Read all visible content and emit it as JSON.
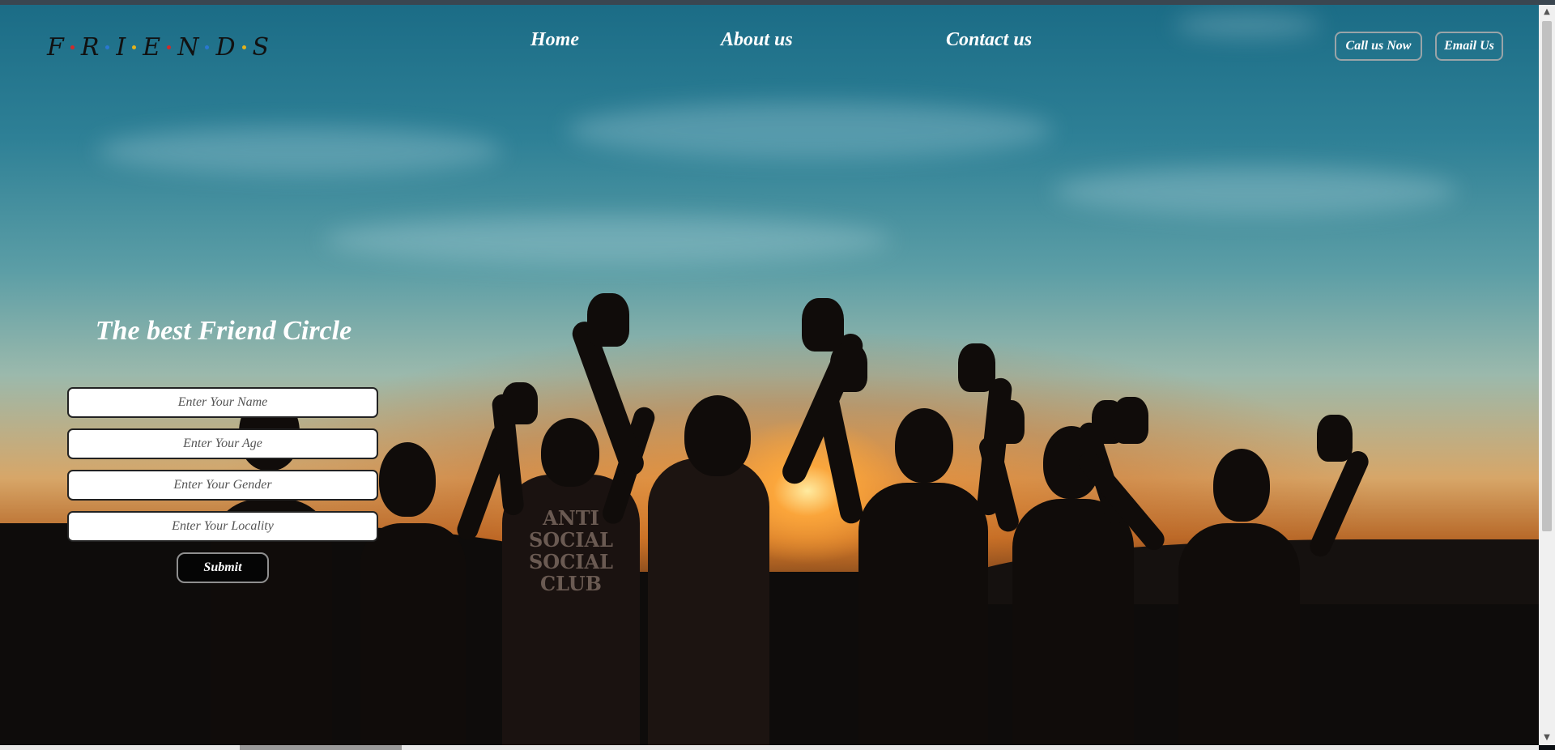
{
  "logo": {
    "letters": [
      "F",
      "R",
      "I",
      "E",
      "N",
      "D",
      "S"
    ],
    "dot_colors": [
      "#d12a2a",
      "#2a78d1",
      "#e3b21a",
      "#d12a2a",
      "#2a78d1",
      "#e3b21a"
    ]
  },
  "nav": {
    "items": [
      {
        "label": "Home"
      },
      {
        "label": "About us"
      },
      {
        "label": "Contact us"
      }
    ]
  },
  "header_buttons": {
    "call_label": "Call us Now",
    "email_label": "Email Us"
  },
  "hero": {
    "title": "The best Friend Circle"
  },
  "form": {
    "fields": [
      {
        "placeholder": "Enter Your Name",
        "value": ""
      },
      {
        "placeholder": "Enter Your Age",
        "value": ""
      },
      {
        "placeholder": "Enter Your Gender",
        "value": ""
      },
      {
        "placeholder": "Enter Your Locality",
        "value": ""
      }
    ],
    "submit_label": "Submit"
  },
  "shirt_print": {
    "text": "ANTI SOCIAL SOCIAL CLUB"
  },
  "scrollbar": {
    "up_icon": "triangle-up-icon",
    "down_icon": "triangle-down-icon"
  }
}
